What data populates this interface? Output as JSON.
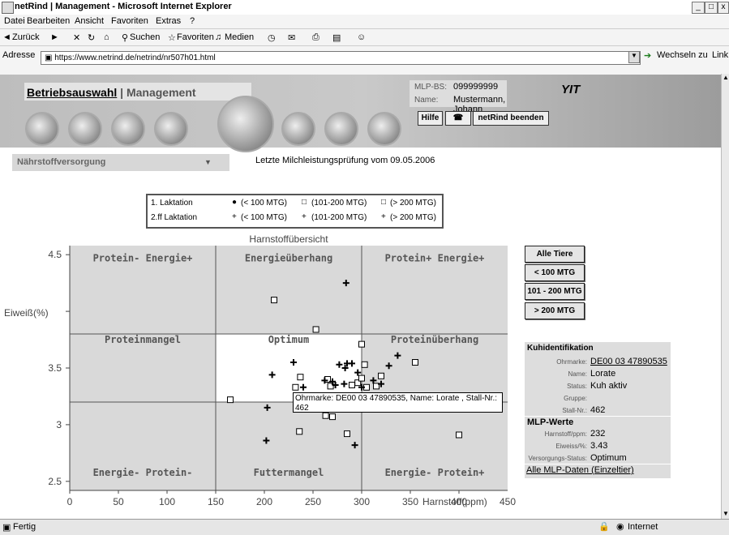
{
  "window": {
    "title": "netRind | Management - Microsoft Internet Explorer",
    "menu": [
      "Datei",
      "Bearbeiten",
      "Ansicht",
      "Favoriten",
      "Extras",
      "?"
    ],
    "toolbar": [
      "Zurück",
      "Suchen",
      "Favoriten",
      "Medien"
    ],
    "address_label": "Adresse",
    "address": "https://www.netrind.de/netrind/nr507h01.html",
    "go_label": "Wechseln zu",
    "links_label": "Link",
    "status_left": "Fertig",
    "status_zone": "Internet"
  },
  "header": {
    "betriebsauswahl": "Betriebsauswahl",
    "separator": "|",
    "management": "Management",
    "mlp_label": "MLP-BS:",
    "mlp_value": "099999999",
    "name_label": "Name:",
    "name_value": "Mustermann, Johann",
    "logo": "YIT",
    "help": "Hilfe",
    "end": "netRind beenden"
  },
  "page": {
    "dropdown": "Nährstoffversorgung",
    "last_check": "Letzte Milchleistungsprüfung vom 09.05.2006"
  },
  "legend": {
    "row1_label": "1. Laktation",
    "row2_label": "2.ff Laktation",
    "lt100": "(< 100 MTG)",
    "mid": "(101-200 MTG)",
    "gt200": "(> 200 MTG)",
    "mid_row2": "(101-200 MTG)"
  },
  "buttons": {
    "all": "Alle Tiere",
    "lt100": "< 100 MTG",
    "mid": "101 - 200 MTG",
    "gt200": "> 200 MTG"
  },
  "kuh": {
    "title": "Kuhidentifikation",
    "ohrmarke_label": "Ohrmarke:",
    "ohrmarke": "DE00 03 47890535",
    "name_label": "Name:",
    "name": "Lorate",
    "status_label": "Status:",
    "status": "Kuh aktiv",
    "gruppe_label": "Gruppe:",
    "gruppe": "",
    "stall_label": "Stall-Nr.:",
    "stall": "462",
    "mlp_title": "MLP-Werte",
    "harn_label": "Harnstoff/ppm:",
    "harn": "232",
    "eiweiss_label": "Eiweiss/%:",
    "eiweiss": "3.43",
    "vs_label": "Versorgungs-Status:",
    "vs": "Optimum",
    "all_link": "Alle MLP-Daten (Einzeltier)"
  },
  "tooltip": {
    "line1": "Ohrmarke: DE00 03 47890535, Name: Lorate    , Stall-Nr.:",
    "line2": "462"
  },
  "colors": {
    "chart_gray": "#d9d9d9",
    "chart_white": "#ffffff",
    "link": "#000000"
  },
  "chart_data": {
    "type": "scatter",
    "title": "Harnstoffübersicht",
    "xlabel": "Harnstoff(ppm)",
    "ylabel": "Eiweiß(%)",
    "xlim": [
      0,
      450
    ],
    "ylim": [
      2.42,
      4.58
    ],
    "x_ticks": [
      0,
      50,
      100,
      150,
      200,
      250,
      300,
      350,
      400,
      450
    ],
    "y_ticks": [
      2.5,
      3,
      3.5,
      4.5
    ],
    "optimum": {
      "x": [
        150,
        300
      ],
      "y": [
        3.2,
        3.8
      ]
    },
    "regions": [
      {
        "label": "Protein- Energie+",
        "x": 75,
        "y": 4.44
      },
      {
        "label": "Energieüberhang",
        "x": 225,
        "y": 4.44
      },
      {
        "label": "Protein+ Energie+",
        "x": 375,
        "y": 4.44
      },
      {
        "label": "Proteinmangel",
        "x": 75,
        "y": 3.72
      },
      {
        "label": "Optimum",
        "x": 225,
        "y": 3.72
      },
      {
        "label": "Proteinüberhang",
        "x": 375,
        "y": 3.72
      },
      {
        "label": "Energie- Protein-",
        "x": 75,
        "y": 2.55
      },
      {
        "label": "Futtermangel",
        "x": 225,
        "y": 2.55
      },
      {
        "label": "Energie- Protein+",
        "x": 375,
        "y": 2.55
      }
    ],
    "series": [
      {
        "marker": "square",
        "points": [
          [
            210,
            4.1
          ],
          [
            253,
            3.84
          ],
          [
            165,
            3.22
          ],
          [
            237,
            3.42
          ],
          [
            232,
            3.33
          ],
          [
            265,
            3.4
          ],
          [
            268,
            3.34
          ],
          [
            290,
            3.35
          ],
          [
            296,
            3.37
          ],
          [
            300,
            3.41
          ],
          [
            303,
            3.53
          ],
          [
            300,
            3.71
          ],
          [
            305,
            3.33
          ],
          [
            315,
            3.34
          ],
          [
            320,
            3.43
          ],
          [
            355,
            3.55
          ],
          [
            236,
            2.94
          ],
          [
            263,
            3.08
          ],
          [
            270,
            3.07
          ],
          [
            285,
            2.92
          ],
          [
            400,
            2.91
          ],
          [
            280,
            3.18
          ]
        ]
      },
      {
        "marker": "plus",
        "points": [
          [
            284,
            4.25
          ],
          [
            230,
            3.55
          ],
          [
            208,
            3.44
          ],
          [
            240,
            3.33
          ],
          [
            262,
            3.39
          ],
          [
            270,
            3.38
          ],
          [
            277,
            3.53
          ],
          [
            285,
            3.54
          ],
          [
            290,
            3.54
          ],
          [
            296,
            3.46
          ],
          [
            312,
            3.39
          ],
          [
            320,
            3.36
          ],
          [
            328,
            3.52
          ],
          [
            337,
            3.61
          ],
          [
            273,
            3.35
          ],
          [
            203,
            3.15
          ],
          [
            282,
            3.36
          ],
          [
            300,
            3.33
          ],
          [
            202,
            2.86
          ],
          [
            293,
            2.82
          ],
          [
            283,
            3.5
          ]
        ]
      }
    ]
  }
}
